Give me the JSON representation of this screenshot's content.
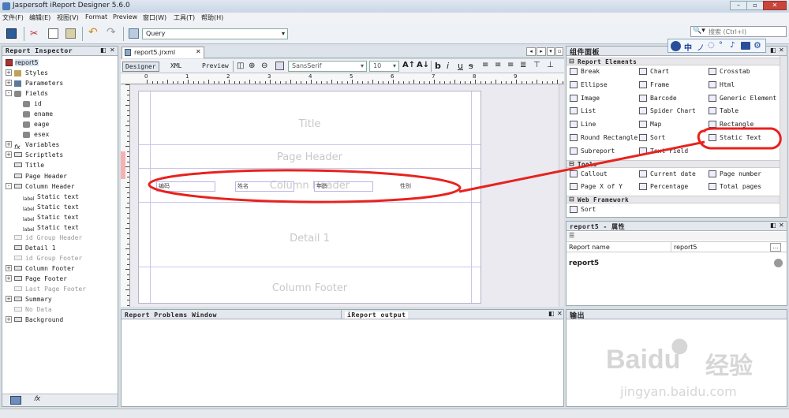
{
  "window": {
    "title": "Jaspersoft iReport Designer 5.6.0"
  },
  "menu": [
    "文件(F)",
    "编辑(E)",
    "视图(V)",
    "Format",
    "Preview",
    "窗口(W)",
    "工具(T)",
    "帮助(H)"
  ],
  "toolbar": {
    "query_value": "Query"
  },
  "search": {
    "placeholder": "搜索 (Ctrl+I)"
  },
  "inspector": {
    "title": "Report Inspector",
    "root": "report5",
    "items": [
      {
        "label": "Styles"
      },
      {
        "label": "Parameters"
      },
      {
        "label": "Fields"
      },
      {
        "label": "id"
      },
      {
        "label": "ename"
      },
      {
        "label": "eage"
      },
      {
        "label": "esex"
      },
      {
        "label": "Variables"
      },
      {
        "label": "Scriptlets"
      },
      {
        "label": "Title"
      },
      {
        "label": "Page Header"
      },
      {
        "label": "Column Header"
      },
      {
        "label": "Static text"
      },
      {
        "label": "Static text"
      },
      {
        "label": "Static text"
      },
      {
        "label": "Static text"
      },
      {
        "label": "id Group Header"
      },
      {
        "label": "Detail 1"
      },
      {
        "label": "id Group Footer"
      },
      {
        "label": "Column Footer"
      },
      {
        "label": "Page Footer"
      },
      {
        "label": "Last Page Footer"
      },
      {
        "label": "Summary"
      },
      {
        "label": "No Data"
      },
      {
        "label": "Background"
      }
    ]
  },
  "editor": {
    "tab": "report5.jrxml",
    "modes": [
      "Designer",
      "XML",
      "Preview"
    ],
    "font": "SansSerif",
    "size": "10",
    "ruler_numbers": [
      "0",
      "1",
      "2",
      "3",
      "4",
      "5",
      "6",
      "7",
      "8",
      "9"
    ],
    "bands": [
      "Title",
      "Page Header",
      "Column Header",
      "Detail 1",
      "Column Footer"
    ],
    "column_fields": [
      "编码",
      "姓名",
      "年龄",
      "性别"
    ]
  },
  "palette": {
    "title": "组件面板",
    "sections": [
      {
        "name": "Report Elements",
        "items": [
          "Break",
          "Chart",
          "Crosstab",
          "Ellipse",
          "Frame",
          "Html",
          "Image",
          "Barcode",
          "Generic Element",
          "List",
          "Spider Chart",
          "Table",
          "Line",
          "Map",
          "Rectangle",
          "Round Rectangle",
          "Sort",
          "Static Text",
          "Subreport",
          "Text Field"
        ]
      },
      {
        "name": "Tools",
        "items": [
          "Callout",
          "Current date",
          "Page number",
          "Page X of Y",
          "Percentage",
          "Total pages"
        ]
      },
      {
        "name": "Web Framework",
        "items": [
          "Sort"
        ]
      }
    ]
  },
  "properties": {
    "title": "report5 - 属性",
    "row_label": "Report name",
    "row_value": "report5",
    "footer": "report5"
  },
  "bottom": {
    "tab1": "Report Problems Window",
    "tab2": "iReport output",
    "output_title": "输出"
  },
  "watermark": {
    "brand": "Baidu",
    "cn": "经验",
    "url": "jingyan.baidu.com"
  },
  "colors": {
    "annotation": "#e8221e",
    "band_line": "#c9c6ec"
  }
}
